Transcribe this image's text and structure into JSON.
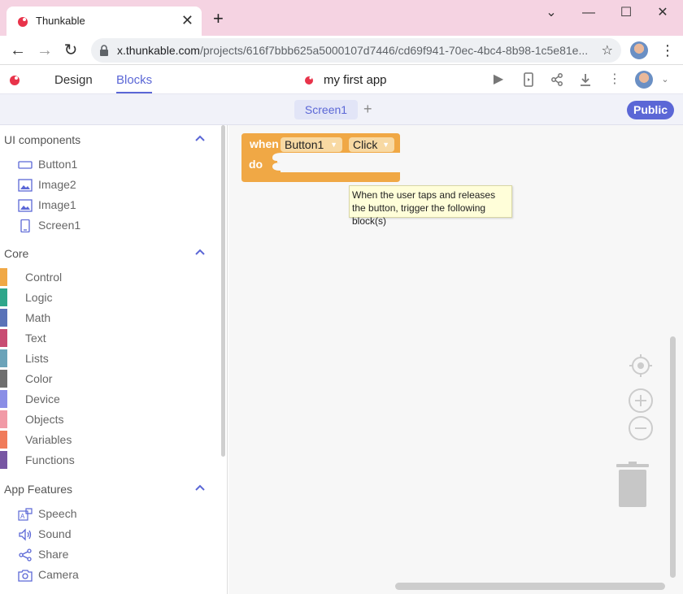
{
  "browser": {
    "tab_title": "Thunkable",
    "tab_close": "✕",
    "new_tab": "+",
    "url_host": "x.thunkable.com",
    "url_path": "/projects/616f7bbb625a5000107d7446/cd69f941-70ec-4bc4-8b98-1c5e81e...",
    "window_controls": {
      "minimize": "⌄",
      "restore": "—",
      "maximize": "☐",
      "close": "✕"
    }
  },
  "app": {
    "mode_tabs": [
      {
        "label": "Design"
      },
      {
        "label": "Blocks"
      }
    ],
    "active_tab": "Blocks",
    "project_title": "my first app",
    "accent_color": "#5b67d6"
  },
  "screens": {
    "current": "Screen1",
    "add": "+",
    "public_label": "Public"
  },
  "sidebar": {
    "ui_components": {
      "title": "UI components",
      "items": [
        {
          "label": "Button1",
          "icon": "button-icon"
        },
        {
          "label": "Image2",
          "icon": "image-icon"
        },
        {
          "label": "Image1",
          "icon": "image-icon"
        },
        {
          "label": "Screen1",
          "icon": "screen-icon"
        }
      ]
    },
    "core": {
      "title": "Core",
      "items": [
        {
          "label": "Control",
          "color": "#f0a845"
        },
        {
          "label": "Logic",
          "color": "#2ea68a"
        },
        {
          "label": "Math",
          "color": "#5a73b8"
        },
        {
          "label": "Text",
          "color": "#c84c72"
        },
        {
          "label": "Lists",
          "color": "#6ba3b9"
        },
        {
          "label": "Color",
          "color": "#6e6e6e"
        },
        {
          "label": "Device",
          "color": "#8a8ee6"
        },
        {
          "label": "Objects",
          "color": "#f19aa6"
        },
        {
          "label": "Variables",
          "color": "#f07b5a"
        },
        {
          "label": "Functions",
          "color": "#7756a3"
        }
      ]
    },
    "app_features": {
      "title": "App Features",
      "items": [
        {
          "label": "Speech",
          "icon": "speech-icon"
        },
        {
          "label": "Sound",
          "icon": "sound-icon"
        },
        {
          "label": "Share",
          "icon": "share-icon"
        },
        {
          "label": "Camera",
          "icon": "camera-icon"
        }
      ]
    }
  },
  "workspace": {
    "event_block": {
      "when": "when",
      "component": "Button1",
      "event": "Click",
      "do": "do",
      "color": "#f0a845"
    },
    "tooltip": "When the user taps and releases the button, trigger the following block(s)"
  }
}
